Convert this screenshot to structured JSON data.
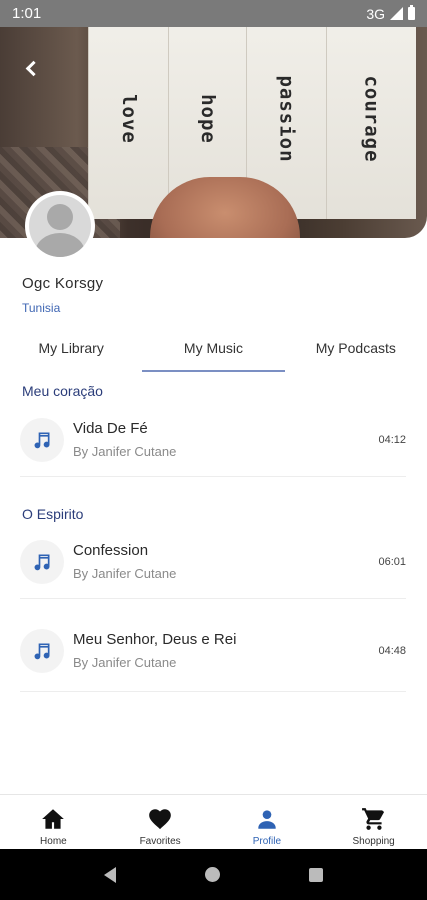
{
  "status_bar": {
    "time": "1:01",
    "network": "3G"
  },
  "hero": {
    "paper_words": [
      "love",
      "hope",
      "passion",
      "courage"
    ]
  },
  "profile": {
    "name": "Ogc Korsgy",
    "location": "Tunisia"
  },
  "tabs": [
    {
      "label": "My Library",
      "active": false
    },
    {
      "label": "My Music",
      "active": true
    },
    {
      "label": "My Podcasts",
      "active": false
    }
  ],
  "sections": [
    {
      "title": "Meu coração",
      "tracks": [
        {
          "title": "Vida De Fé",
          "artist": "By Janifer Cutane",
          "duration": "04:12"
        }
      ]
    },
    {
      "title": "O Espirito",
      "tracks": [
        {
          "title": "Confession",
          "artist": "By Janifer Cutane",
          "duration": "06:01"
        },
        {
          "title": "Meu Senhor, Deus e Rei",
          "artist": "By Janifer Cutane",
          "duration": "04:48"
        }
      ]
    }
  ],
  "bottom_nav": [
    {
      "label": "Home",
      "icon": "home-icon",
      "active": false
    },
    {
      "label": "Favorites",
      "icon": "heart-icon",
      "active": false
    },
    {
      "label": "Profile",
      "icon": "person-icon",
      "active": true
    },
    {
      "label": "Shopping",
      "icon": "cart-icon",
      "active": false
    }
  ],
  "colors": {
    "accent": "#2f63b4",
    "section_title": "#2b3d7a",
    "tab_indicator": "#7b8fc3"
  }
}
